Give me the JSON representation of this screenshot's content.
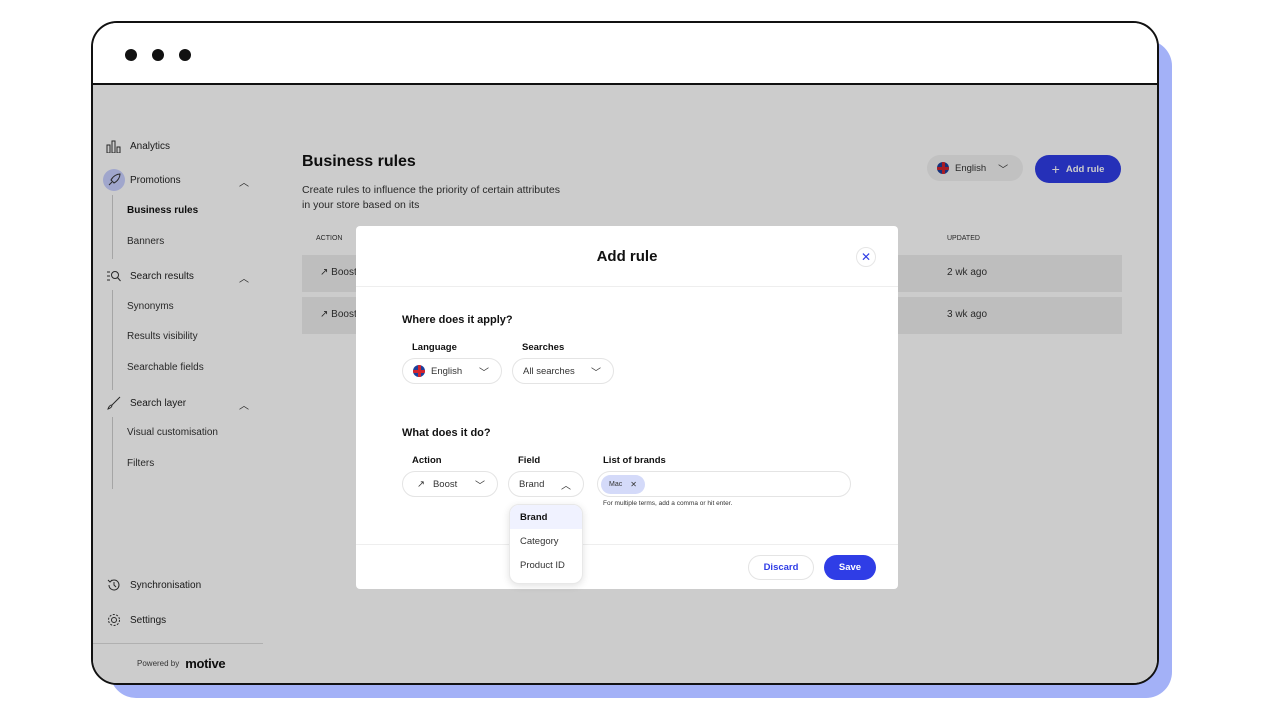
{
  "colors": {
    "accent": "#2f3de6",
    "frame_shadow": "#a3b1f7",
    "chip": "#d4daf9",
    "nav_active": "#c9d0ff"
  },
  "sidebar": {
    "items": [
      {
        "label": "Analytics",
        "icon": "bar-chart-icon"
      },
      {
        "label": "Promotions",
        "icon": "rocket-icon",
        "expanded": true,
        "children": [
          "Business rules",
          "Banners"
        ],
        "active_child": "Business rules"
      },
      {
        "label": "Search results",
        "icon": "search-list-icon",
        "expanded": true,
        "children": [
          "Synonyms",
          "Results visibility",
          "Searchable fields"
        ]
      },
      {
        "label": "Search layer",
        "icon": "brush-icon",
        "expanded": true,
        "children": [
          "Visual customisation",
          "Filters"
        ]
      },
      {
        "label": "Synchronisation",
        "icon": "history-icon"
      },
      {
        "label": "Settings",
        "icon": "gear-icon"
      }
    ],
    "powered_by": "Powered by",
    "brand": "motive"
  },
  "page": {
    "title": "Business rules",
    "description": "Create rules to influence the priority of certain attributes in your store based on its",
    "language": "English",
    "add_rule": "Add rule",
    "table": {
      "headers": {
        "action": "ACTION",
        "updated": "UPDATED"
      },
      "rows": [
        {
          "action": "Boost",
          "updated": "2 wk ago"
        },
        {
          "action": "Boost",
          "updated": "3 wk ago"
        }
      ]
    }
  },
  "modal": {
    "title": "Add rule",
    "section1": {
      "title": "Where does it apply?",
      "language_label": "Language",
      "language_value": "English",
      "searches_label": "Searches",
      "searches_value": "All searches"
    },
    "section2": {
      "title": "What does it do?",
      "action_label": "Action",
      "action_value": "Boost",
      "field_label": "Field",
      "field_value": "Brand",
      "brands_label": "List of brands",
      "brands": [
        "Mac"
      ],
      "helper": "For multiple terms, add a comma or hit enter.",
      "field_options": [
        "Brand",
        "Category",
        "Product ID"
      ],
      "field_selected": "Brand"
    },
    "discard": "Discard",
    "save": "Save"
  }
}
